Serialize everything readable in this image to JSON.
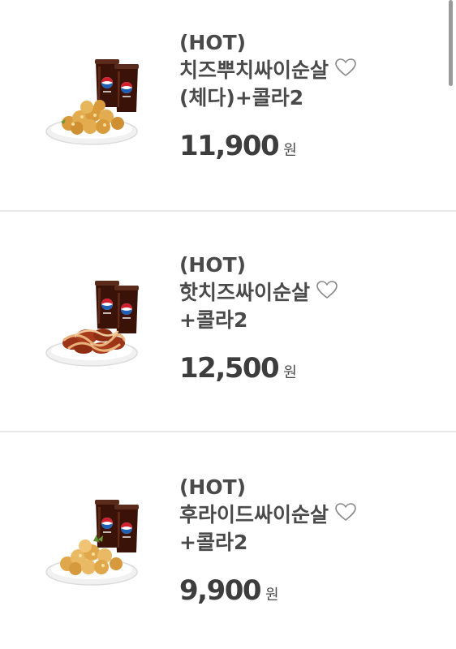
{
  "menu_items": [
    {
      "tag": "(HOT)",
      "name_line1": "치즈뿌치싸이순살",
      "name_line2": "(체다)+콜라2",
      "price": "11,900",
      "currency": "원",
      "image_icon": "chicken-bites-with-two-colas",
      "favorited": false
    },
    {
      "tag": "(HOT)",
      "name_line1": "핫치즈싸이순살",
      "name_line2": "+콜라2",
      "price": "12,500",
      "currency": "원",
      "image_icon": "sauced-chicken-with-two-colas",
      "favorited": false
    },
    {
      "tag": "(HOT)",
      "name_line1": "후라이드싸이순살",
      "name_line2": "+콜라2",
      "price": "9,900",
      "currency": "원",
      "image_icon": "fried-chicken-with-two-colas",
      "favorited": false
    }
  ],
  "colors": {
    "text": "#4a4a4a",
    "price": "#3d3d3d",
    "divider": "#e8e8e8",
    "heart_outline": "#8a8a8a",
    "cola": "#3a1208",
    "pepsi_blue": "#1f5fb4",
    "pepsi_red": "#d3202e",
    "fried_chicken": "#d99a3b",
    "sauced_chicken": "#9c3418",
    "sauce_drizzle": "#e8b27a"
  }
}
